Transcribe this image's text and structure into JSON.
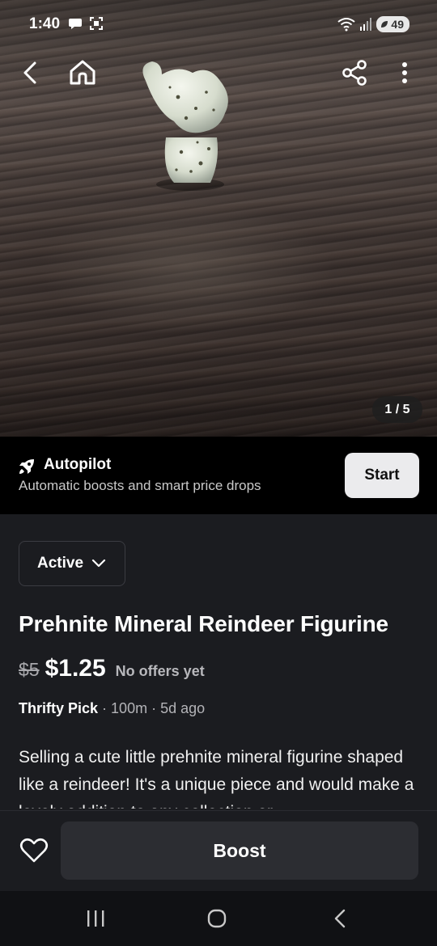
{
  "status_bar": {
    "time": "1:40",
    "battery": "49",
    "icons": [
      "chat-bubble-icon",
      "screenshot-icon",
      "wifi-icon",
      "signal-icon",
      "battery-icon"
    ]
  },
  "nav": {
    "back_icon": "chevron-left-icon",
    "home_icon": "home-icon",
    "share_icon": "share-icon",
    "more_icon": "more-vertical-icon"
  },
  "photo": {
    "counter": "1 / 5"
  },
  "autopilot": {
    "title": "Autopilot",
    "subtitle": "Automatic boosts and smart price drops",
    "button": "Start",
    "icon": "rocket-icon"
  },
  "listing": {
    "status": "Active",
    "title": "Prehnite Mineral Reindeer Figurine",
    "old_price": "$5",
    "price": "$1.25",
    "offers": "No offers yet",
    "seller": "Thrifty Pick",
    "distance": "· 100m",
    "posted": "· 5d ago",
    "description": "Selling a cute little prehnite mineral figurine shaped like a reindeer! It's a unique piece and would make a lovely addition to any collection or"
  },
  "bottom": {
    "boost": "Boost",
    "favorite_icon": "heart-icon"
  },
  "colors": {
    "background": "#1b1c20",
    "banner": "#000000",
    "button_light": "#ebebed",
    "button_dark": "#2c2d32"
  }
}
